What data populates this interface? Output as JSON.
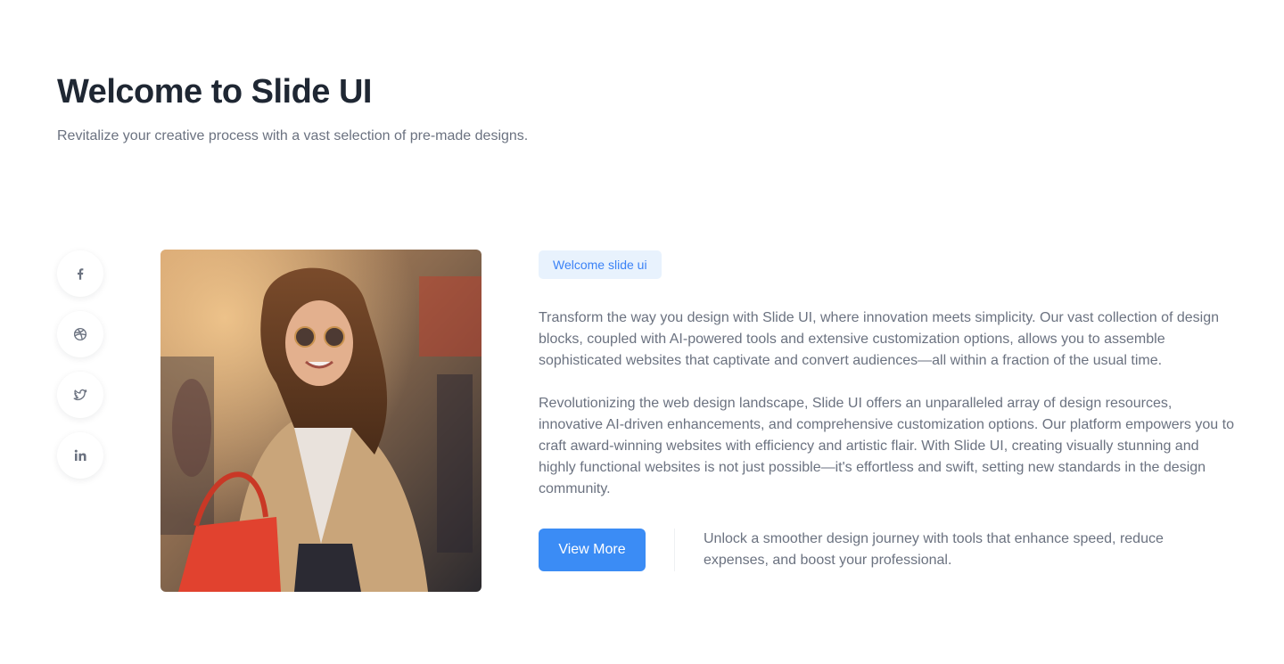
{
  "header": {
    "title": "Welcome to Slide UI",
    "subtitle": "Revitalize your creative process with a vast selection of pre-made designs."
  },
  "social": [
    {
      "name": "facebook",
      "icon": "facebook-icon"
    },
    {
      "name": "dribbble",
      "icon": "dribbble-icon"
    },
    {
      "name": "twitter",
      "icon": "twitter-icon"
    },
    {
      "name": "linkedin",
      "icon": "linkedin-icon"
    }
  ],
  "content": {
    "badge": "Welcome slide ui",
    "paragraph_1": "Transform the way you design with Slide UI, where innovation meets simplicity. Our vast collection of design blocks, coupled with AI-powered tools and extensive customization options, allows you to assemble sophisticated websites that captivate and convert audiences—all within a fraction of the usual time.",
    "paragraph_2": "Revolutionizing the web design landscape, Slide UI offers an unparalleled array of design resources, innovative AI-driven enhancements, and comprehensive customization options. Our platform empowers you to craft award-winning websites with efficiency and artistic flair. With Slide UI, creating visually stunning and highly functional websites is not just possible—it's effortless and swift, setting new standards in the design community.",
    "cta_label": "View More",
    "cta_text": "Unlock a smoother design journey with tools that enhance speed, reduce expenses, and boost your professional."
  },
  "colors": {
    "accent": "#3b8cf5",
    "badge_bg": "#e8f2fd",
    "badge_text": "#3b82f6",
    "body_text": "#6b7280",
    "title_text": "#1f2733"
  }
}
